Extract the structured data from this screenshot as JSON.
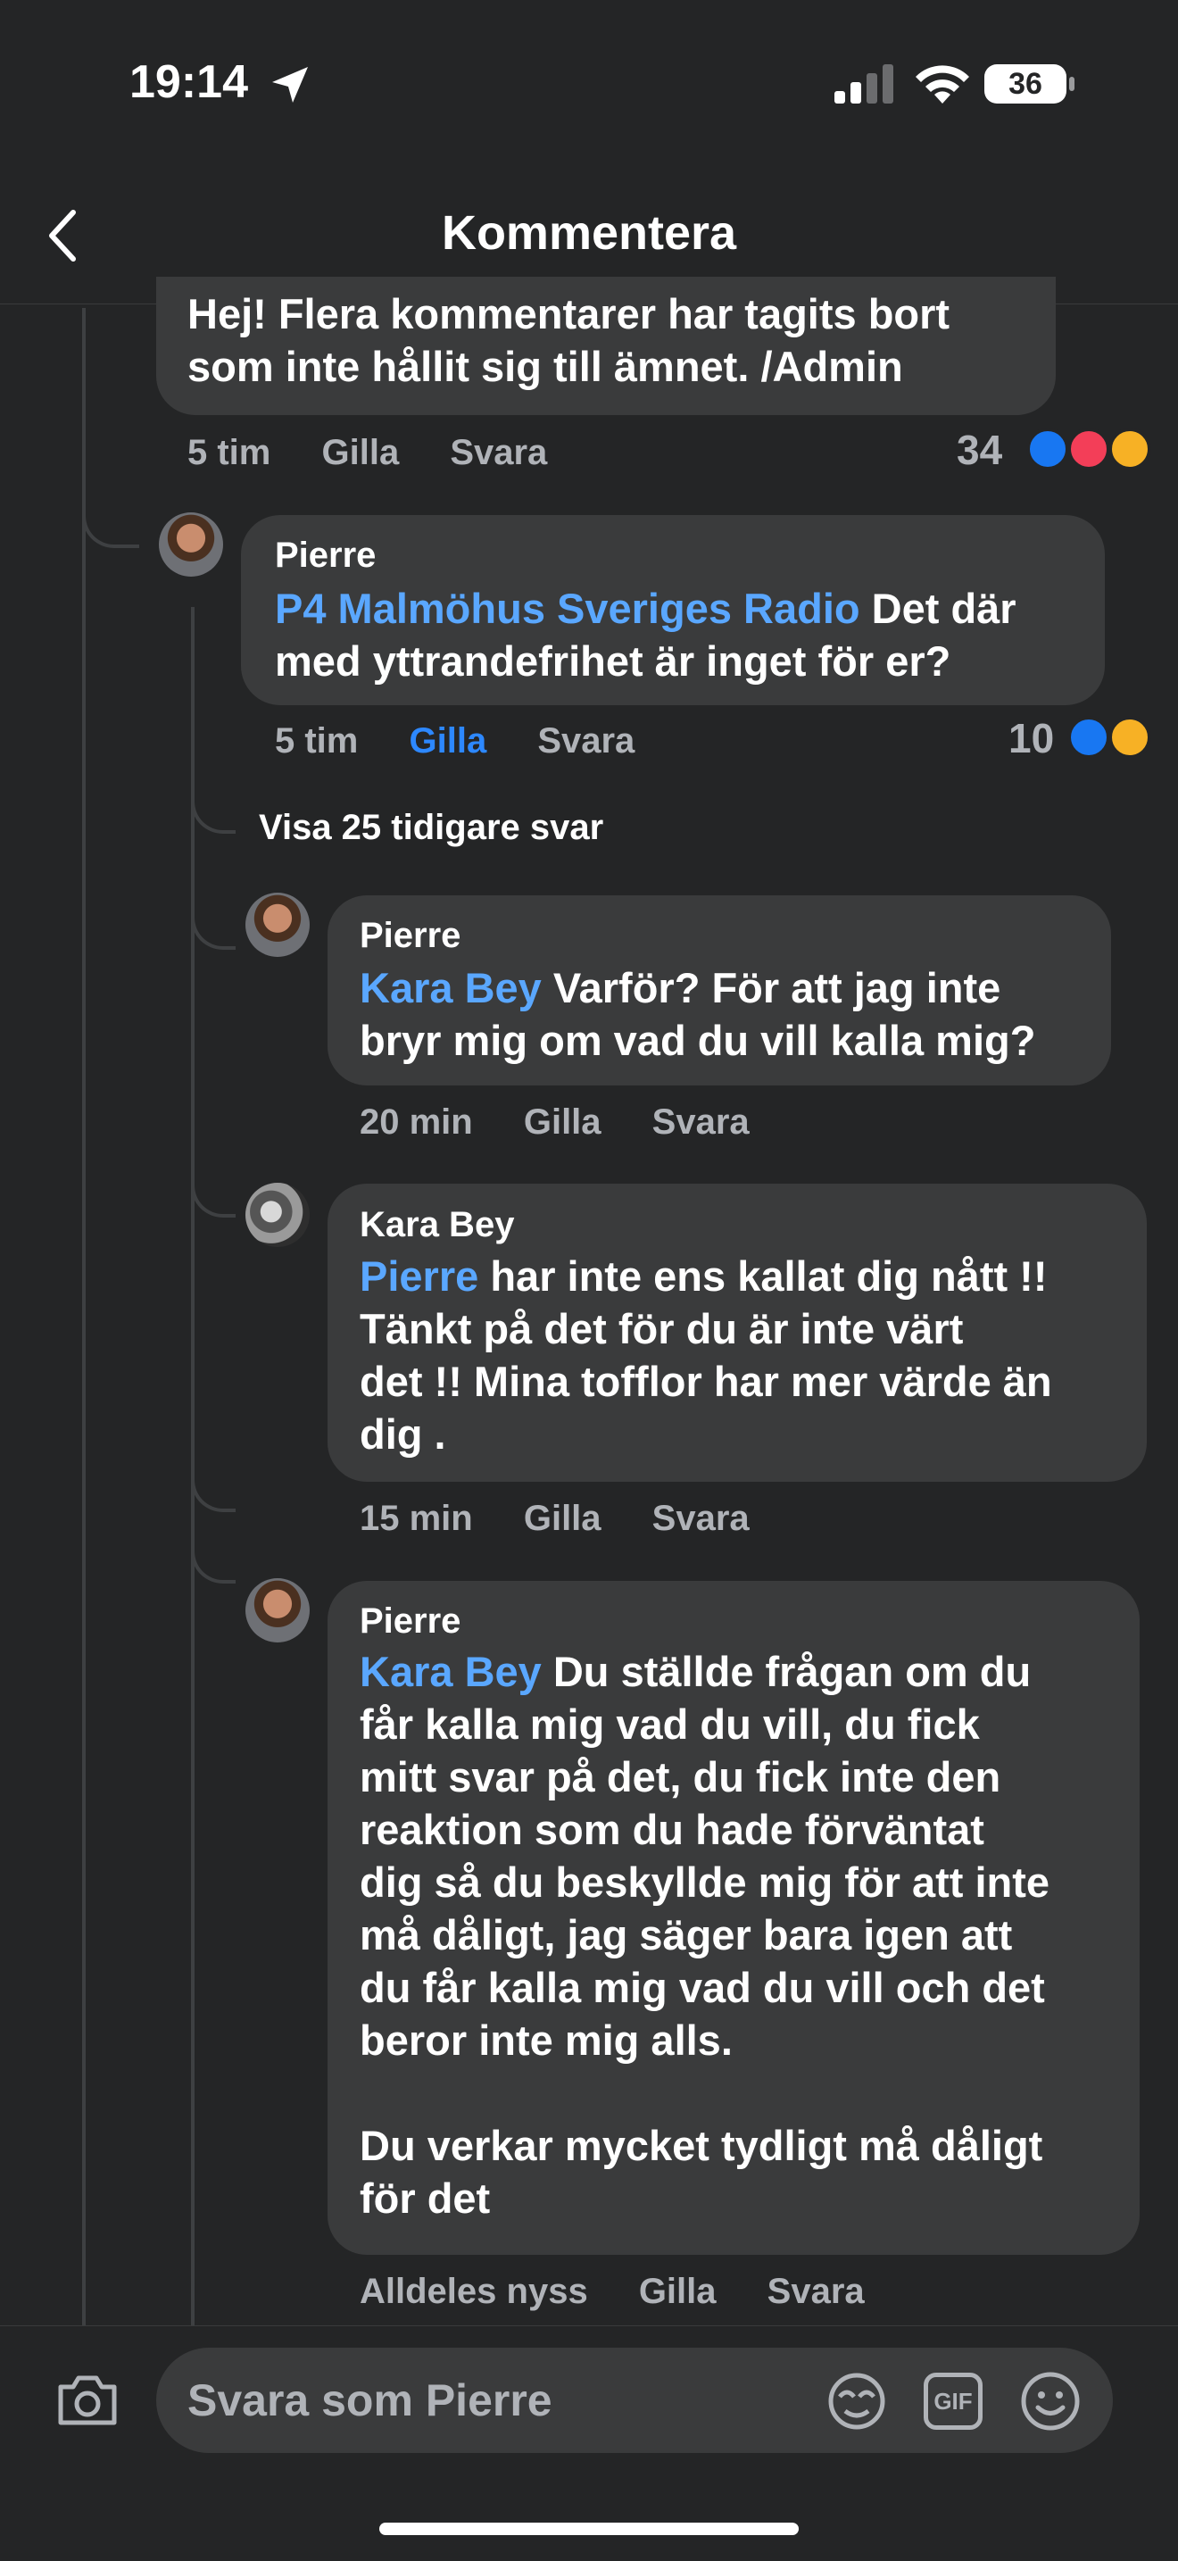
{
  "status_bar": {
    "time": "19:14",
    "battery": "36"
  },
  "header": {
    "title": "Kommentera"
  },
  "top_comment": {
    "text_line1": "Hej! Flera kommentarer har tagits bort",
    "text_line2": "som inte hållit sig till ämnet. /Admin",
    "time": "5 tim",
    "like": "Gilla",
    "reply": "Svara",
    "reaction_count": "34"
  },
  "comments": [
    {
      "author": "Pierre",
      "mention": "P4 Malmöhus Sveriges Radio",
      "text_line1": " Det där",
      "text_line2": "med yttrandefrihet är inget för er?",
      "time": "5 tim",
      "like": "Gilla",
      "reply": "Svara",
      "reaction_count": "10"
    },
    {
      "author": "Pierre",
      "mention": "Kara Bey",
      "text_line1": " Varför? För att jag inte",
      "text_line2": "bryr mig om vad du vill kalla mig?",
      "time": "20 min",
      "like": "Gilla",
      "reply": "Svara"
    },
    {
      "author": "Kara Bey",
      "mention": "Pierre",
      "text_line1": " har inte ens kallat dig nått !!",
      "text_line2": "Tänkt på det för du är inte värt",
      "text_line3": "det !! Mina tofflor har mer värde än",
      "text_line4": "dig .",
      "time": "15 min",
      "like": "Gilla",
      "reply": "Svara"
    },
    {
      "author": "Pierre",
      "mention": "Kara Bey",
      "text_line1": " Du ställde frågan om du",
      "text_line2": "får kalla mig vad du vill, du fick",
      "text_line3": "mitt svar på det, du fick inte den",
      "text_line4": "reaktion som du hade förväntat",
      "text_line5": "dig så du beskyllde mig för att inte",
      "text_line6": "må dåligt, jag säger bara igen att",
      "text_line7": "du får kalla mig vad du vill och det",
      "text_line8": "beror inte mig alls.",
      "text_line9": "Du verkar mycket tydligt må dåligt",
      "text_line10": "för det",
      "time": "Alldeles nyss",
      "like": "Gilla",
      "reply": "Svara"
    }
  ],
  "show_more": "Visa 25 tidigare svar",
  "composer": {
    "placeholder": "Svara som Pierre",
    "gif_label": "GIF"
  },
  "colors": {
    "background": "#242526",
    "bubble": "#3a3b3c",
    "mention": "#5aa7ff",
    "liked": "#2d88ff"
  }
}
